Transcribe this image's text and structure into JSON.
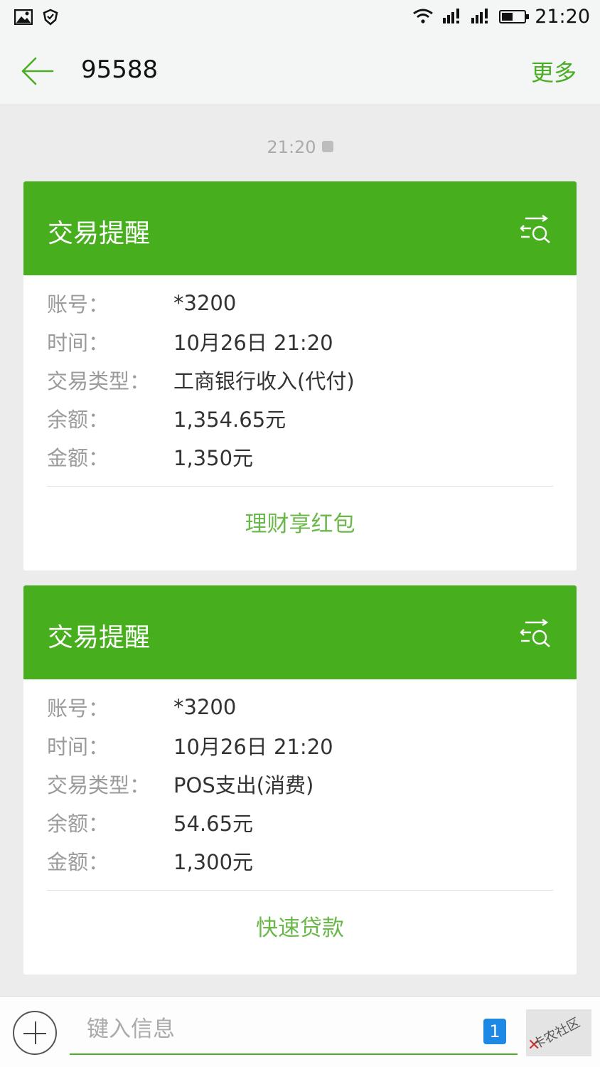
{
  "status_bar": {
    "time": "21:20",
    "left_icons": [
      "image-icon",
      "shield-icon"
    ],
    "right_icons": [
      "wifi-icon",
      "signal-icon",
      "signal-icon",
      "battery-icon"
    ],
    "battery_level": 0.5
  },
  "header": {
    "title": "95588",
    "more_label": "更多"
  },
  "conversation": {
    "timestamp": "21:20",
    "sim_tag": "1"
  },
  "messages": [
    {
      "title": "交易提醒",
      "rows": [
        {
          "label": "账号：",
          "value": "*3200"
        },
        {
          "label": "时间：",
          "value": "10月26日 21:20"
        },
        {
          "label": "交易类型：",
          "value": "工商银行收入(代付)"
        },
        {
          "label": "余额：",
          "value": "1,354.65元"
        },
        {
          "label": "金额：",
          "value": "1,350元"
        }
      ],
      "link": "理财享红包"
    },
    {
      "title": "交易提醒",
      "rows": [
        {
          "label": "账号：",
          "value": "*3200"
        },
        {
          "label": "时间：",
          "value": "10月26日 21:20"
        },
        {
          "label": "交易类型：",
          "value": "POS支出(消费)"
        },
        {
          "label": "余额：",
          "value": "54.65元"
        },
        {
          "label": "金额：",
          "value": "1,300元"
        }
      ],
      "link": "快速贷款"
    }
  ],
  "composer": {
    "placeholder": "键入信息",
    "sim_badge": "1",
    "watermark_text": "卡农社区"
  },
  "colors": {
    "accent": "#47ae1e",
    "link": "#6ab84a",
    "sim_badge": "#1e88e5"
  }
}
